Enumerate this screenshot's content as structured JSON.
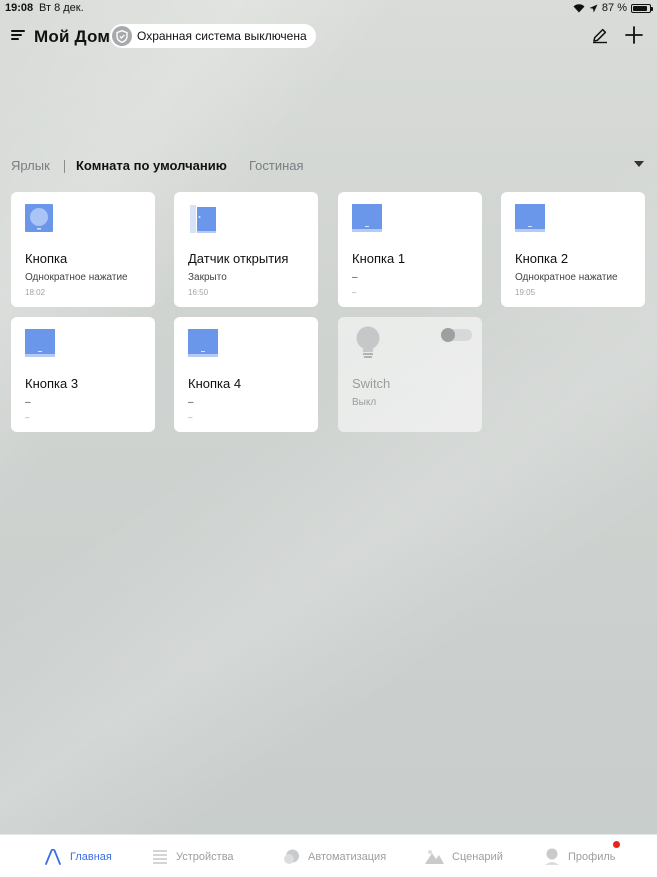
{
  "status_bar": {
    "time": "19:08",
    "date": "Вт 8 дек.",
    "battery": "87 %",
    "battery_level": 0.87
  },
  "header": {
    "title": "Мой Дом",
    "security_status": "Охранная система выключена"
  },
  "tabs": {
    "shortcut": "Ярлык",
    "default_room": "Комната по умолчанию",
    "living_room": "Гостиная"
  },
  "devices": [
    {
      "name": "Кнопка",
      "status": "Однократное нажатие",
      "time": "18:02",
      "icon": "round-button-icon"
    },
    {
      "name": "Датчик открытия",
      "status": "Закрыто",
      "time": "16:50",
      "icon": "door-sensor-icon"
    },
    {
      "name": "Кнопка 1",
      "status": "–",
      "time": "–",
      "icon": "square-button-icon"
    },
    {
      "name": "Кнопка 2",
      "status": "Однократное нажатие",
      "time": "19:05",
      "icon": "square-button-icon"
    },
    {
      "name": "Кнопка 3",
      "status": "–",
      "time": "–",
      "icon": "square-button-icon"
    },
    {
      "name": "Кнопка 4",
      "status": "–",
      "time": "–",
      "icon": "square-button-icon"
    },
    {
      "name": "Switch",
      "status": "Выкл",
      "icon": "lightbulb-icon",
      "toggle_on": false
    }
  ],
  "bottom_nav": {
    "home": "Главная",
    "devices": "Устройства",
    "automation": "Автоматизация",
    "scenes": "Сценарий",
    "profile": "Профиль"
  },
  "colors": {
    "accent": "#3c6ee6",
    "device_blue": "#6a97ea",
    "notification": "#e7231a"
  }
}
